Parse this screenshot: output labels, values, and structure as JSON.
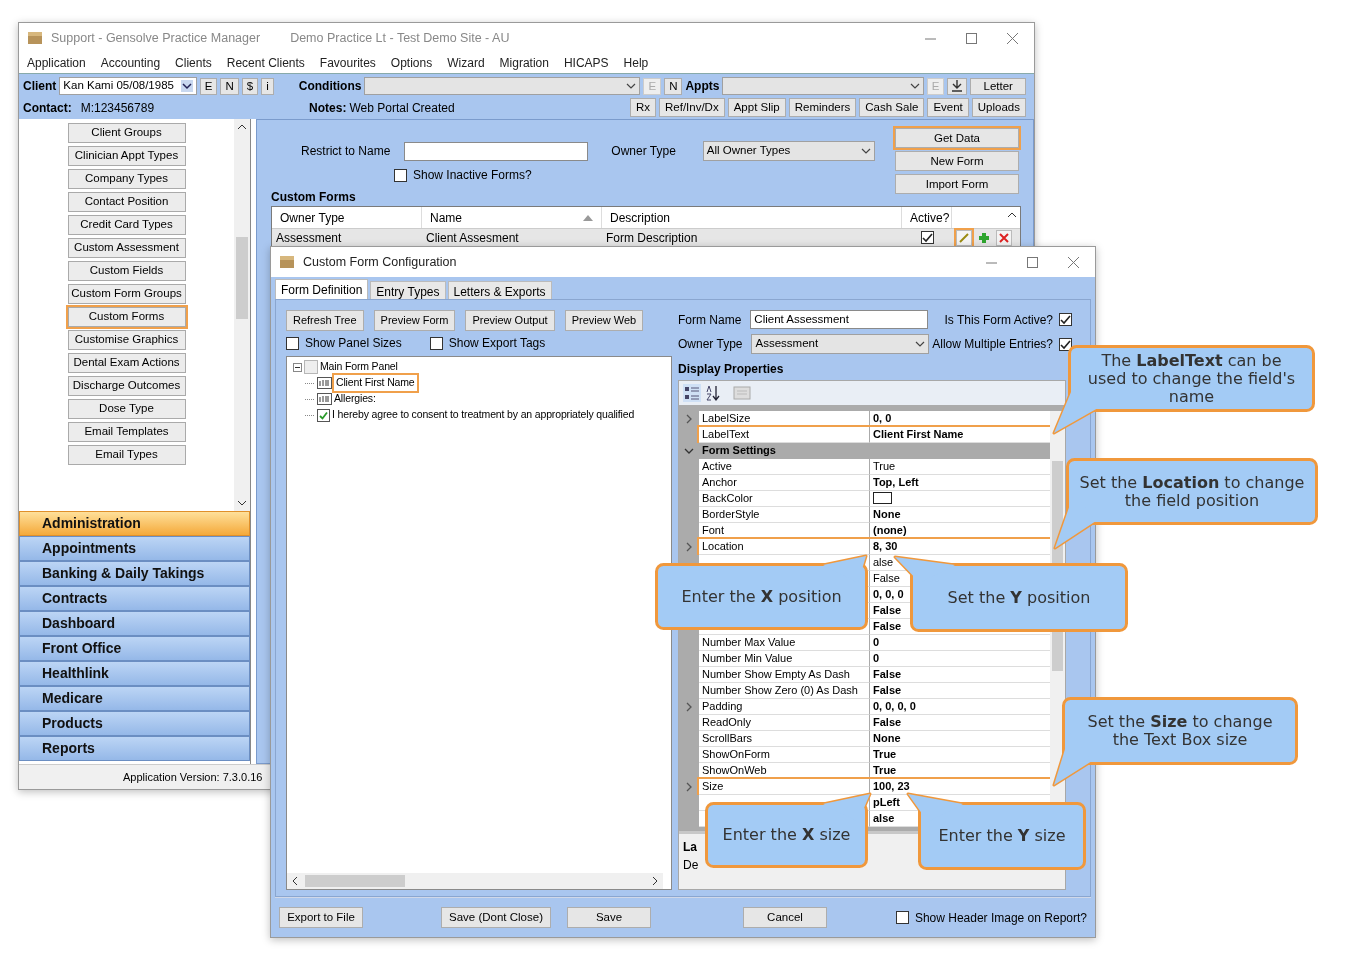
{
  "app_window": {
    "title": "Support - Gensolve Practice Manager",
    "subtitle": "Demo Practice Lt - Test Demo Site - AU"
  },
  "menu": [
    "Application",
    "Accounting",
    "Clients",
    "Recent Clients",
    "Favourites",
    "Options",
    "Wizard",
    "Migration",
    "HICAPS",
    "Help"
  ],
  "client_bar": {
    "client_label": "Client",
    "client_value": "Kan Kami 05/08/1985",
    "client_buttons": [
      {
        "label": "E",
        "disabled": false
      },
      {
        "label": "N",
        "disabled": false
      },
      {
        "label": "$",
        "disabled": false
      },
      {
        "label": "i",
        "disabled": false
      }
    ],
    "conditions_label": "Conditions",
    "condition_buttons": [
      {
        "label": "E",
        "disabled": true
      },
      {
        "label": "N",
        "disabled": false
      }
    ],
    "appts_label": "Appts",
    "appt_buttons": [
      {
        "kind": "text",
        "label": "E",
        "disabled": true
      },
      {
        "kind": "download",
        "disabled": false
      }
    ],
    "letter_button": "Letter",
    "contact_label": "Contact:",
    "contact_value": "M:123456789",
    "notes_label": "Notes:",
    "notes_value": "Web Portal Created",
    "actions": [
      "Rx",
      "Ref/Inv/Dx",
      "Appt Slip",
      "Reminders",
      "Cash Sale",
      "Event",
      "Uploads"
    ]
  },
  "admin_list": [
    {
      "label": "Client Groups",
      "highlighted": false
    },
    {
      "label": "Clinician Appt Types",
      "highlighted": false
    },
    {
      "label": "Company Types",
      "highlighted": false
    },
    {
      "label": "Contact Position",
      "highlighted": false
    },
    {
      "label": "Credit Card Types",
      "highlighted": false
    },
    {
      "label": "Custom Assessment",
      "highlighted": false
    },
    {
      "label": "Custom Fields",
      "highlighted": false
    },
    {
      "label": "Custom Form Groups",
      "highlighted": false
    },
    {
      "label": "Custom Forms",
      "highlighted": true
    },
    {
      "label": "Customise Graphics",
      "highlighted": false
    },
    {
      "label": "Dental Exam Actions",
      "highlighted": false
    },
    {
      "label": "Discharge Outcomes",
      "highlighted": false
    },
    {
      "label": "Dose Type",
      "highlighted": false
    },
    {
      "label": "Email Templates",
      "highlighted": false
    },
    {
      "label": "Email Types",
      "highlighted": false
    }
  ],
  "nav_sections": [
    {
      "label": "Administration",
      "selected": true
    },
    {
      "label": "Appointments",
      "selected": false
    },
    {
      "label": "Banking & Daily Takings",
      "selected": false
    },
    {
      "label": "Contracts",
      "selected": false
    },
    {
      "label": "Dashboard",
      "selected": false
    },
    {
      "label": "Front Office",
      "selected": false
    },
    {
      "label": "Healthlink",
      "selected": false
    },
    {
      "label": "Medicare",
      "selected": false
    },
    {
      "label": "Products",
      "selected": false
    },
    {
      "label": "Reports",
      "selected": false
    }
  ],
  "status_bar": "Application Version: 7.3.0.16",
  "custom_forms": {
    "restrict_label": "Restrict to Name",
    "owner_type_label": "Owner Type",
    "owner_type_value": "All Owner Types",
    "show_inactive": {
      "label": "Show Inactive Forms?",
      "checked": false
    },
    "buttons": [
      {
        "label": "Get Data",
        "highlighted": true
      },
      {
        "label": "New Form",
        "highlighted": false
      },
      {
        "label": "Import Form",
        "highlighted": false
      }
    ],
    "title": "Custom Forms",
    "columns": [
      {
        "label": "Owner Type",
        "sorted": false
      },
      {
        "label": "Name",
        "sorted": true
      },
      {
        "label": "Description",
        "sorted": false
      },
      {
        "label": "Active?",
        "sorted": false
      }
    ],
    "rows": [
      {
        "owner_type": "Assessment",
        "name": "Client Assesment",
        "description": "Form Description",
        "active": true,
        "edit_highlighted": true
      }
    ]
  },
  "dialog": {
    "title": "Custom Form Configuration",
    "tabs": [
      {
        "label": "Form Definition",
        "selected": true
      },
      {
        "label": "Entry Types",
        "selected": false
      },
      {
        "label": "Letters & Exports",
        "selected": false
      }
    ],
    "tree_buttons": [
      "Refresh Tree",
      "Preview Form",
      "Preview Output",
      "Preview Web"
    ],
    "tree_options": [
      {
        "label": "Show Panel Sizes",
        "checked": false
      },
      {
        "label": "Show Export Tags",
        "checked": false
      }
    ],
    "tree": [
      {
        "label": "Main Form Panel",
        "kind": "panel",
        "expanded": true,
        "highlighted": false,
        "children": [
          {
            "label": "Client First Name",
            "kind": "label",
            "highlighted": true
          },
          {
            "label": "Allergies:",
            "kind": "label",
            "highlighted": false
          },
          {
            "label": "I hereby agree to consent to treatment by an appropriately qualified",
            "kind": "checkbox",
            "highlighted": false
          }
        ]
      }
    ],
    "form_name_label": "Form Name",
    "form_name_value": "Client Assessment",
    "owner_type_label": "Owner Type",
    "owner_type_value": "Assessment",
    "flags": [
      {
        "label": "Is This Form Active?",
        "checked": true
      },
      {
        "label": "Allow Multiple Entries?",
        "checked": true
      }
    ],
    "properties_title": "Display Properties",
    "properties": [
      {
        "kind": "property",
        "name": "LabelSize",
        "value": "0, 0",
        "expandable": true,
        "bold": true,
        "highlighted": false
      },
      {
        "kind": "property",
        "name": "LabelText",
        "value": "Client First Name",
        "expandable": false,
        "bold": true,
        "highlighted": true
      },
      {
        "kind": "category",
        "name": "Form Settings",
        "expanded": true
      },
      {
        "kind": "property",
        "name": "Active",
        "value": "True",
        "expandable": false,
        "bold": false,
        "highlighted": false
      },
      {
        "kind": "property",
        "name": "Anchor",
        "value": "Top, Left",
        "expandable": false,
        "bold": true,
        "highlighted": false
      },
      {
        "kind": "color",
        "name": "BackColor",
        "color": "#ffffff",
        "highlighted": false
      },
      {
        "kind": "property",
        "name": "BorderStyle",
        "value": "None",
        "expandable": false,
        "bold": true,
        "highlighted": false
      },
      {
        "kind": "property",
        "name": "Font",
        "value": "(none)",
        "expandable": false,
        "bold": true,
        "highlighted": false
      },
      {
        "kind": "property",
        "name": "Location",
        "value": "8, 30",
        "expandable": true,
        "bold": true,
        "highlighted": true
      },
      {
        "kind": "property",
        "value": "alse",
        "expandable": false,
        "bold": false
      },
      {
        "kind": "property",
        "value": "False",
        "expandable": false,
        "bold": false
      },
      {
        "kind": "property",
        "value": "0, 0, 0",
        "expandable": false,
        "bold": true
      },
      {
        "kind": "property",
        "value": "False",
        "expandable": false,
        "bold": true
      },
      {
        "kind": "property",
        "value": "False",
        "expandable": false,
        "bold": true
      },
      {
        "kind": "property",
        "name": "Number Max Value",
        "value": "0",
        "expandable": false,
        "bold": true,
        "highlighted": false
      },
      {
        "kind": "property",
        "name": "Number Min Value",
        "value": "0",
        "expandable": false,
        "bold": true,
        "highlighted": false
      },
      {
        "kind": "property",
        "name": "Number Show Empty As Dash",
        "value": "False",
        "expandable": false,
        "bold": true,
        "highlighted": false
      },
      {
        "kind": "property",
        "name": "Number Show Zero (0) As Dash",
        "value": "False",
        "expandable": false,
        "bold": true,
        "highlighted": false
      },
      {
        "kind": "property",
        "name": "Padding",
        "value": "0, 0, 0, 0",
        "expandable": true,
        "bold": true,
        "highlighted": false
      },
      {
        "kind": "property",
        "name": "ReadOnly",
        "value": "False",
        "expandable": false,
        "bold": true,
        "highlighted": false
      },
      {
        "kind": "property",
        "name": "ScrollBars",
        "value": "None",
        "expandable": false,
        "bold": true,
        "highlighted": false
      },
      {
        "kind": "property",
        "name": "ShowOnForm",
        "value": "True",
        "expandable": false,
        "bold": true,
        "highlighted": false
      },
      {
        "kind": "property",
        "name": "ShowOnWeb",
        "value": "True",
        "expandable": false,
        "bold": true,
        "highlighted": false
      },
      {
        "kind": "property",
        "name": "Size",
        "value": "100, 23",
        "expandable": true,
        "bold": true,
        "highlighted": true
      },
      {
        "kind": "property",
        "value": "pLeft",
        "expandable": false,
        "bold": true
      },
      {
        "kind": "property",
        "value": "alse",
        "expandable": false,
        "bold": true
      }
    ],
    "description_lines": [
      "La",
      "De"
    ],
    "bottom_buttons": [
      "Export to File",
      "Save (Dont Close)",
      "Save",
      "Cancel"
    ],
    "header_option": {
      "label": "Show Header Image on Report?",
      "checked": false
    }
  },
  "callouts": [
    {
      "text": "The **LabelText** can be used to change the field's name"
    },
    {
      "text": "Set the **Location** to change the field position"
    },
    {
      "text": "Enter the **X** position"
    },
    {
      "text": "Set the **Y** position"
    },
    {
      "text": "Set the **Size** to change the Text Box size"
    },
    {
      "text": "Enter the **X** size"
    },
    {
      "text": "Enter the **Y** size"
    }
  ]
}
